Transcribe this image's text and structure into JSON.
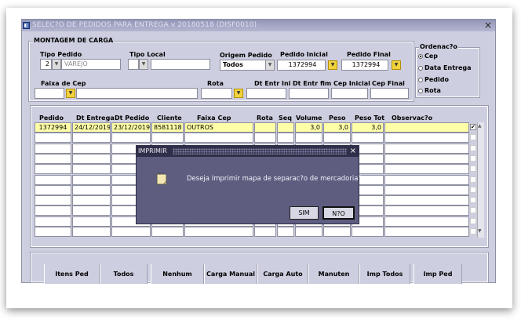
{
  "window": {
    "title": "SELEC?O DE PEDIDOS PARA ENTREGA v 20180518 (DISF0010)",
    "close_glyph": "×"
  },
  "montagem": {
    "group_label": "MONTAGEM DE CARGA",
    "tipo_pedido_label": "Tipo Pedido",
    "tipo_pedido_code": "2",
    "tipo_pedido_desc": "VAREJO",
    "tipo_local_label": "Tipo Local",
    "tipo_local_code": "",
    "tipo_local_desc": "",
    "origem_pedido_label": "Origem Pedido",
    "origem_pedido_value": "Todos",
    "pedido_inicial_label": "Pedido Inicial",
    "pedido_inicial_value": "1372994",
    "pedido_final_label": "Pedido Final",
    "pedido_final_value": "1372994",
    "faixa_cep_label": "Faixa de Cep",
    "rota_label": "Rota",
    "dt_entr_ini_label": "Dt Entr Ini",
    "dt_entr_fim_label": "Dt Entr fim",
    "cep_inicial_label": "Cep Inicial",
    "cep_final_label": "Cep Final"
  },
  "ordenacao": {
    "label": "Ordenac?o",
    "options": [
      "Cep",
      "Data Entrega",
      "Pedido",
      "Rota"
    ],
    "selected": "Cep"
  },
  "grid": {
    "columns": [
      "Pedido",
      "Dt Entrega",
      "Dt Pedido",
      "Cliente",
      "Faixa Cep",
      "Rota",
      "Seq",
      "Volume",
      "Peso",
      "Peso Tot",
      "Observac?o"
    ],
    "rows": [
      {
        "pedido": "1372994",
        "dt_entrega": "24/12/2019",
        "dt_pedido": "23/12/2019",
        "cliente": "8581118",
        "faixa_cep": "OUTROS",
        "rota": "",
        "seq": "",
        "volume": "3,0",
        "peso": "3,0",
        "peso_tot": "3,0",
        "observacao": "",
        "checked": true
      }
    ]
  },
  "buttons": [
    "Itens Ped",
    "Todos",
    "Nenhum",
    "Carga Manual",
    "Carga Auto",
    "Manuten",
    "Imp Todos",
    "Imp Ped"
  ],
  "dialog": {
    "title": "IMPRIMIR",
    "close_glyph": "×",
    "message": "Deseja Imprimir mapa de separac?o de mercadoria?",
    "yes_label": "SIM",
    "no_label": "N?O"
  }
}
